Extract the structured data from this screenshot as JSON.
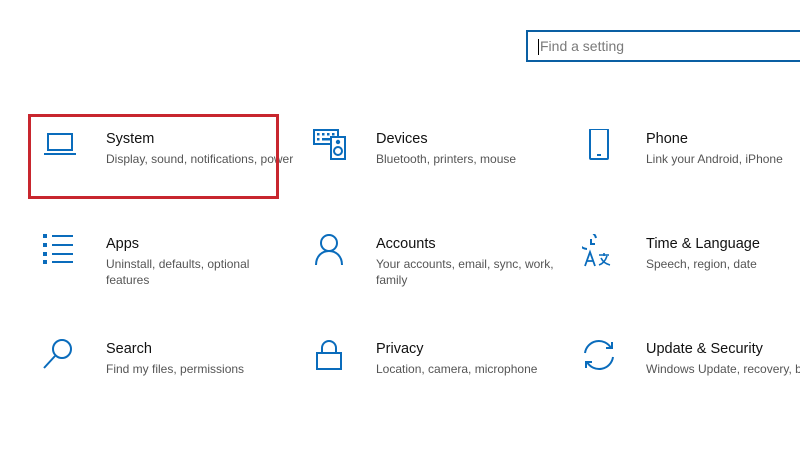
{
  "search": {
    "placeholder": "Find a setting",
    "value": ""
  },
  "colors": {
    "icon": "#0a6cbc",
    "highlight": "#c8262e",
    "search_border": "#0a5fa3"
  },
  "tiles": [
    {
      "title": "System",
      "description": "Display, sound, notifications, power",
      "icon": "laptop-icon",
      "highlighted": true
    },
    {
      "title": "Devices",
      "description": "Bluetooth, printers, mouse",
      "icon": "keyboard-speaker-icon"
    },
    {
      "title": "Phone",
      "description": "Link your Android, iPhone",
      "icon": "phone-icon"
    },
    {
      "title": "Apps",
      "description": "Uninstall, defaults, optional features",
      "icon": "apps-list-icon"
    },
    {
      "title": "Accounts",
      "description": "Your accounts, email, sync, work, family",
      "icon": "person-icon"
    },
    {
      "title": "Time & Language",
      "description": "Speech, region, date",
      "icon": "time-language-icon"
    },
    {
      "title": "Search",
      "description": "Find my files, permissions",
      "icon": "magnifier-icon"
    },
    {
      "title": "Privacy",
      "description": "Location, camera, microphone",
      "icon": "lock-icon"
    },
    {
      "title": "Update & Security",
      "description": "Windows Update, recovery, backup",
      "icon": "sync-arrows-icon"
    }
  ]
}
